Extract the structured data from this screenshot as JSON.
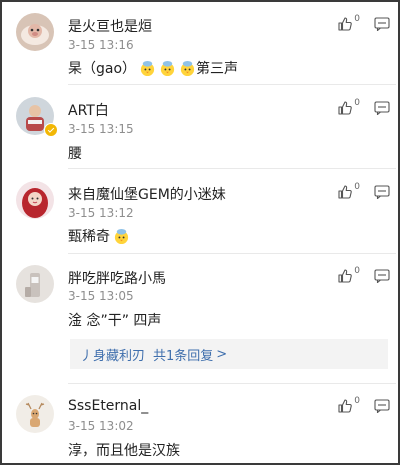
{
  "comments": [
    {
      "username": "是火亘也是烜",
      "time": "3-15 13:16",
      "text": "杲（gao）",
      "suffix": "第三声",
      "emoji_count": 3,
      "likes": "0"
    },
    {
      "username": "ART白",
      "time": "3-15 13:15",
      "text": "腰",
      "likes": "0"
    },
    {
      "username": "来自魔仙堡GEM的小迷妹",
      "time": "3-15 13:12",
      "text": "甄稀奇",
      "likes": "0"
    },
    {
      "username": "胖吃胖吃路小馬",
      "time": "3-15 13:05",
      "text": "淦 念”干” 四声",
      "likes": "0",
      "reply": {
        "author": "丿身藏利刃",
        "summary": "共1条回复",
        "chevron": ">"
      }
    },
    {
      "username": "SssEternal_",
      "time": "3-15 13:02",
      "text": "淳，而且他是汉族",
      "likes": "0"
    }
  ],
  "icons": {
    "like": "thumbs-up-icon",
    "comment": "message-icon",
    "emoji": "chick-emoji-icon",
    "verified": "verified-badge-icon"
  },
  "colors": {
    "link": "#3f6fad",
    "muted": "#8e8e8e",
    "verified": "#f2b705"
  }
}
